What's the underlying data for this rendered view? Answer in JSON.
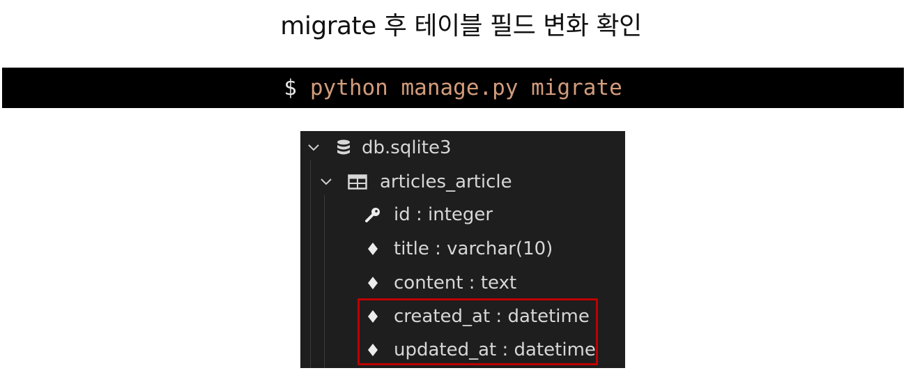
{
  "title": "migrate 후 테이블 필드 변화 확인",
  "terminal": {
    "prompt": "$",
    "command": "python manage.py migrate"
  },
  "tree": {
    "database": {
      "label": "db.sqlite3",
      "icon": "database-icon"
    },
    "table": {
      "label": "articles_article",
      "icon": "table-icon"
    },
    "fields": [
      {
        "label": "id : integer",
        "icon": "key-icon"
      },
      {
        "label": "title : varchar(10)",
        "icon": "diamond-icon"
      },
      {
        "label": "content : text",
        "icon": "diamond-icon"
      },
      {
        "label": "created_at : datetime",
        "icon": "diamond-icon",
        "highlighted": true
      },
      {
        "label": "updated_at : datetime",
        "icon": "diamond-icon",
        "highlighted": true
      }
    ]
  },
  "colors": {
    "terminal_bg": "#000000",
    "command": "#d29c7c",
    "explorer_bg": "#1e1e1e",
    "highlight_border": "#c00000"
  }
}
